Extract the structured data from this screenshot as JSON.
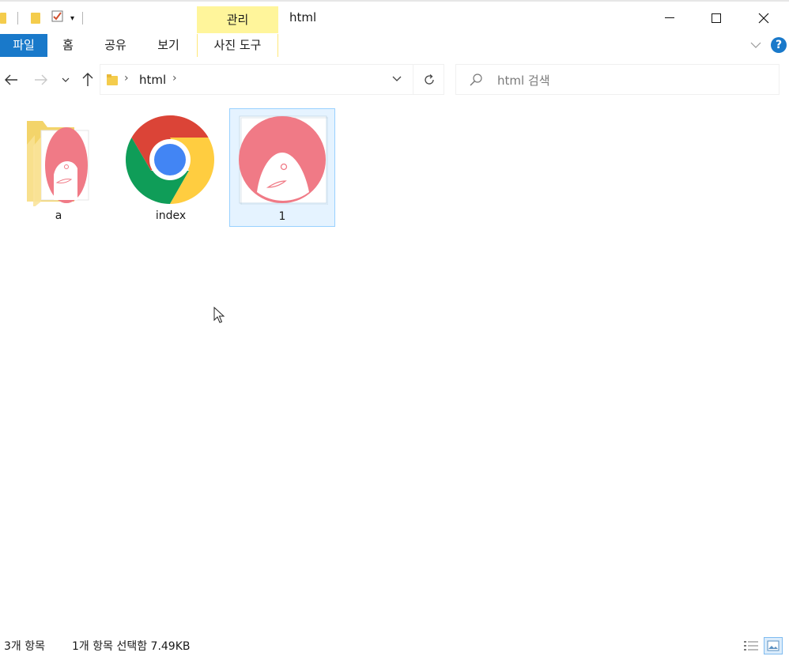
{
  "window": {
    "title": "html",
    "context_tab": "관리"
  },
  "ribbon": {
    "tabs": [
      "파일",
      "홈",
      "공유",
      "보기",
      "사진 도구"
    ]
  },
  "address": {
    "crumb": "html"
  },
  "search": {
    "placeholder": "html 검색",
    "value": ""
  },
  "items": [
    {
      "label": "a",
      "type": "folder",
      "icon": "folder-with-image-icon",
      "selected": false
    },
    {
      "label": "index",
      "type": "html-file",
      "icon": "chrome-icon",
      "selected": false
    },
    {
      "label": "1",
      "type": "image",
      "icon": "image-thumbnail-icon",
      "selected": true
    }
  ],
  "status": {
    "count": "3개 항목",
    "selection": "1개 항목 선택함 7.49KB"
  },
  "colors": {
    "accent": "#1979ca",
    "context_tab": "#fff59b",
    "selection_bg": "#e5f3ff",
    "selection_border": "#99d1ff",
    "thumbnail_face": "#f07a86"
  }
}
